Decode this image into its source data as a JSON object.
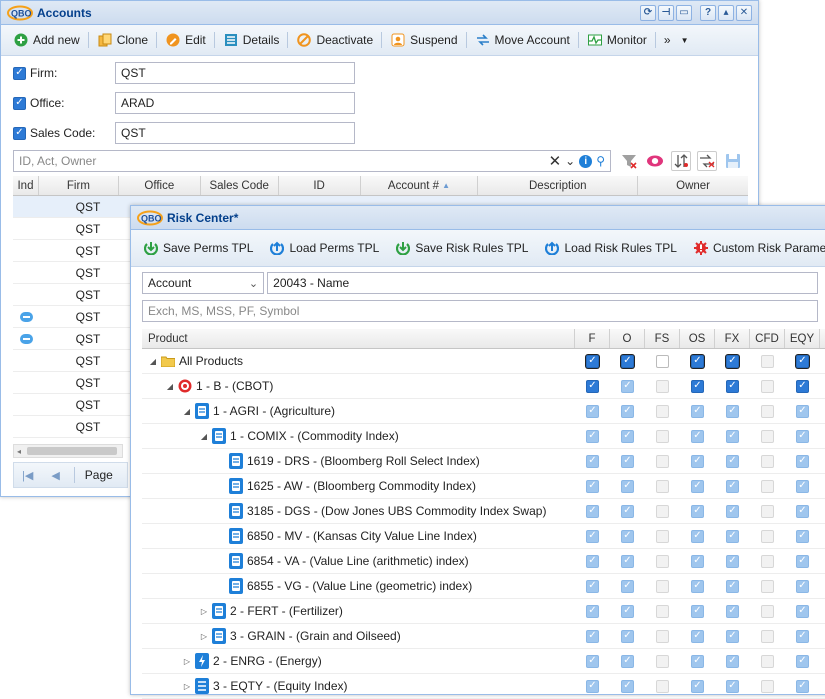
{
  "accounts": {
    "title": "Accounts",
    "logo_text": "QBO",
    "toolbar": [
      {
        "label": "Add new",
        "icon": "add-icon"
      },
      {
        "label": "Clone",
        "icon": "clone-icon"
      },
      {
        "label": "Edit",
        "icon": "edit-icon"
      },
      {
        "label": "Details",
        "icon": "details-icon"
      },
      {
        "label": "Deactivate",
        "icon": "deactivate-icon"
      },
      {
        "label": "Suspend",
        "icon": "suspend-icon"
      },
      {
        "label": "Move Account",
        "icon": "move-icon"
      },
      {
        "label": "Monitor",
        "icon": "monitor-icon"
      }
    ],
    "overflow_label": "»",
    "filters": [
      {
        "label": "Firm:",
        "value": "QST"
      },
      {
        "label": "Office:",
        "value": "ARAD"
      },
      {
        "label": "Sales Code:",
        "value": "QST"
      }
    ],
    "search_placeholder": "ID, Act, Owner",
    "columns": [
      "Ind",
      "Firm",
      "Office",
      "Sales Code",
      "ID",
      "Account #",
      "Description",
      "Owner"
    ],
    "rows": [
      {
        "firm": "QST",
        "ind": ""
      },
      {
        "firm": "QST",
        "ind": ""
      },
      {
        "firm": "QST",
        "ind": ""
      },
      {
        "firm": "QST",
        "ind": ""
      },
      {
        "firm": "QST",
        "ind": ""
      },
      {
        "firm": "QST",
        "ind": "comment"
      },
      {
        "firm": "QST",
        "ind": "comment"
      },
      {
        "firm": "QST",
        "ind": ""
      },
      {
        "firm": "QST",
        "ind": ""
      },
      {
        "firm": "QST",
        "ind": ""
      },
      {
        "firm": "QST",
        "ind": ""
      }
    ],
    "paging_label": "Page"
  },
  "risk": {
    "title": "Risk Center*",
    "logo_text": "QBO",
    "toolbar": [
      {
        "label": "Save Perms TPL",
        "icon": "save-down-icon"
      },
      {
        "label": "Load Perms TPL",
        "icon": "load-up-icon"
      },
      {
        "label": "Save Risk Rules TPL",
        "icon": "save-down-icon"
      },
      {
        "label": "Load Risk Rules TPL",
        "icon": "load-up-icon"
      },
      {
        "label": "Custom Risk Parameters",
        "icon": "gear-red-icon"
      }
    ],
    "selector_value": "Account",
    "account_value": "20043 - Name",
    "filter_placeholder": "Exch, MS, MSS, PF, Symbol",
    "columns": [
      "Product",
      "F",
      "O",
      "FS",
      "OS",
      "FX",
      "CFD",
      "EQY"
    ],
    "rows": [
      {
        "label": "All Products",
        "level": 0,
        "toggle": "expanded",
        "icon": "folder-icon",
        "checks": [
          "on",
          "on",
          "off",
          "on",
          "on",
          "dimoff",
          "on"
        ],
        "ring": true
      },
      {
        "label": "1 - B - (CBOT)",
        "level": 1,
        "toggle": "expanded",
        "icon": "target-icon",
        "checks": [
          "on",
          "dim",
          "dimoff",
          "on",
          "on",
          "dimoff",
          "on"
        ]
      },
      {
        "label": "1 - AGRI - (Agriculture)",
        "level": 2,
        "toggle": "expanded",
        "icon": "commodity-icon",
        "checks": [
          "dim",
          "dim",
          "dimoff",
          "dim",
          "dim",
          "dimoff",
          "dim"
        ]
      },
      {
        "label": "1 - COMIX - (Commodity Index)",
        "level": 3,
        "toggle": "expanded",
        "icon": "commodity-icon",
        "checks": [
          "dim",
          "dim",
          "dimoff",
          "dim",
          "dim",
          "dimoff",
          "dim"
        ]
      },
      {
        "label": "1619 - DRS - (Bloomberg Roll Select Index)",
        "level": 4,
        "toggle": "",
        "icon": "commodity-icon",
        "checks": [
          "dim",
          "dim",
          "dimoff",
          "dim",
          "dim",
          "dimoff",
          "dim"
        ]
      },
      {
        "label": "1625 - AW - (Bloomberg Commodity Index)",
        "level": 4,
        "toggle": "",
        "icon": "commodity-icon",
        "checks": [
          "dim",
          "dim",
          "dimoff",
          "dim",
          "dim",
          "dimoff",
          "dim"
        ]
      },
      {
        "label": "3185 - DGS - (Dow Jones UBS Commodity Index Swap)",
        "level": 4,
        "toggle": "",
        "icon": "commodity-icon",
        "checks": [
          "dim",
          "dim",
          "dimoff",
          "dim",
          "dim",
          "dimoff",
          "dim"
        ]
      },
      {
        "label": "6850 - MV - (Kansas City Value Line Index)",
        "level": 4,
        "toggle": "",
        "icon": "commodity-icon",
        "checks": [
          "dim",
          "dim",
          "dimoff",
          "dim",
          "dim",
          "dimoff",
          "dim"
        ]
      },
      {
        "label": "6854 - VA - (Value Line (arithmetic) index)",
        "level": 4,
        "toggle": "",
        "icon": "commodity-icon",
        "checks": [
          "dim",
          "dim",
          "dimoff",
          "dim",
          "dim",
          "dimoff",
          "dim"
        ]
      },
      {
        "label": "6855 - VG - (Value Line (geometric) index)",
        "level": 4,
        "toggle": "",
        "icon": "commodity-icon",
        "checks": [
          "dim",
          "dim",
          "dimoff",
          "dim",
          "dim",
          "dimoff",
          "dim"
        ]
      },
      {
        "label": "2 - FERT - (Fertilizer)",
        "level": 3,
        "toggle": "collapsed",
        "icon": "commodity-icon",
        "checks": [
          "dim",
          "dim",
          "dimoff",
          "dim",
          "dim",
          "dimoff",
          "dim"
        ]
      },
      {
        "label": "3 - GRAIN - (Grain and Oilseed)",
        "level": 3,
        "toggle": "collapsed",
        "icon": "commodity-icon",
        "checks": [
          "dim",
          "dim",
          "dimoff",
          "dim",
          "dim",
          "dimoff",
          "dim"
        ]
      },
      {
        "label": "2 - ENRG - (Energy)",
        "level": 2,
        "toggle": "collapsed",
        "icon": "energy-icon",
        "checks": [
          "dim",
          "dim",
          "dimoff",
          "dim",
          "dim",
          "dimoff",
          "dim"
        ]
      },
      {
        "label": "3 - EQTY - (Equity Index)",
        "level": 2,
        "toggle": "collapsed",
        "icon": "equity-icon",
        "checks": [
          "dim",
          "dim",
          "dimoff",
          "dim",
          "dim",
          "dimoff",
          "dim"
        ]
      }
    ]
  },
  "colors": {
    "accent": "#2d7ad6",
    "title": "#04408c",
    "red": "#e02b2b"
  }
}
